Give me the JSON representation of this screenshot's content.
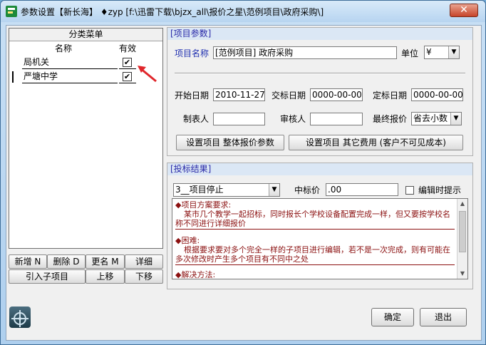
{
  "window": {
    "title": "参数设置【新长海】 ♦zyp  [f:\\迅雷下载\\bjzx_all\\报价之星\\范例项目\\政府采购\\]",
    "close_glyph": "✕"
  },
  "left": {
    "header": "分类菜单",
    "col_name": "名称",
    "col_valid": "有效",
    "items": [
      {
        "name": "局机关",
        "checked": "✔"
      },
      {
        "name": "严塘中学",
        "checked": "✔"
      }
    ],
    "buttons_row1": [
      "新增 N",
      "删除 D",
      "更名 M",
      "详细"
    ],
    "buttons_row2": [
      "引入子项目",
      "上移",
      "下移"
    ]
  },
  "project": {
    "title": "[项目参数]",
    "name_label": "项目名称",
    "name_value": "[范例项目] 政府采购",
    "unit_label": "单位",
    "unit_value": "¥",
    "start_label": "开始日期",
    "start_value": "2010-11-27",
    "bid_label": "交标日期",
    "bid_value": "0000-00-00",
    "award_label": "定标日期",
    "award_value": "0000-00-00",
    "maker_label": "制表人",
    "maker_value": "",
    "reviewer_label": "审核人",
    "reviewer_value": "",
    "final_label": "最终报价",
    "final_value": "省去小数",
    "btn_overall": "设置项目 整体报价参数",
    "btn_other": "设置项目 其它费用 (客户不可见成本)"
  },
  "bid": {
    "title": "[投标结果]",
    "status_value": "3__项目停止",
    "price_label": "中标价",
    "price_value": ".00",
    "hint_label": "编辑时提示",
    "sections": [
      {
        "head": "项目方案要求:",
        "body": "某市几个教学一起招标，同时报长个学校设备配置完成一样，但又要按学校名称不同进行详细报价"
      },
      {
        "head": "困难:",
        "body": "根据要求要对多个完全一样的子项目进行编辑，若不是一次完成，则有可能在多次修改时产生多个项目有不同中之处"
      },
      {
        "head": "解决方法:",
        "body": ""
      }
    ]
  },
  "footer": {
    "ok": "确定",
    "cancel": "退出"
  }
}
